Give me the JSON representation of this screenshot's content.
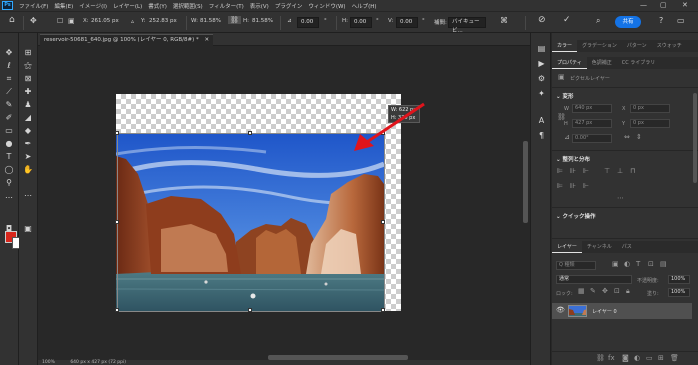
{
  "app": {
    "logo_text": "Ps"
  },
  "menu": [
    "ファイル(F)",
    "編集(E)",
    "イメージ(I)",
    "レイヤー(L)",
    "書式(Y)",
    "選択範囲(S)",
    "フィルター(T)",
    "表示(V)",
    "プラグイン",
    "ウィンドウ(W)",
    "ヘルプ(H)"
  ],
  "window_controls": {
    "minimize": "—",
    "maximize": "▢",
    "close": "✕"
  },
  "options": {
    "x_label": "X:",
    "x_value": "261.05 px",
    "y_label": "Y:",
    "y_value": "252.83 px",
    "w_label": "W:",
    "w_value": "81.58%",
    "h_label": "H:",
    "h_value": "81.58%",
    "angle_label": "⊿",
    "angle_value": "0.00",
    "hskew_label": "H:",
    "hskew_value": "0.00",
    "vskew_label": "V:",
    "vskew_value": "0.00",
    "interp_label": "補間:",
    "interp_value": "バイキュービ...",
    "share_label": "共有"
  },
  "document": {
    "tab_title": "reservoir-50681_640.jpg @ 100% (レイヤー 0, RGB/8#) *",
    "tooltip_w": "W: 622 px",
    "tooltip_h": "H: 336 px",
    "status_zoom": "100%",
    "status_info": "640 px x 427 px (72 ppi)"
  },
  "panels": {
    "top_tabs": [
      "カラー",
      "グラデーション",
      "パターン",
      "スウォッチ"
    ],
    "mid_tabs": [
      "プロパティ",
      "色調補正",
      "CC ライブラリ"
    ],
    "pixel_layer_label": "ピクセルレイヤー",
    "transform_title": "変形",
    "transform_fields": {
      "w": "640 px",
      "x": "0 px",
      "h": "427 px",
      "y": "0 px",
      "angle": "0.00°"
    },
    "align_title": "整列と分布",
    "quick_title": "クイック操作",
    "layer_tabs": [
      "レイヤー",
      "チャンネル",
      "パス"
    ],
    "layer_search": "Q 種類",
    "blend_mode": "通常",
    "opacity_label": "不透明度:",
    "opacity_value": "100%",
    "lock_label": "ロック:",
    "fill_label": "塗り:",
    "fill_value": "100%",
    "layer_name": "レイヤー 0"
  },
  "colors": {
    "accent": "#1473e6",
    "foreground": "#d8261c",
    "background": "#ffffff",
    "arrow": "#e0141c"
  }
}
